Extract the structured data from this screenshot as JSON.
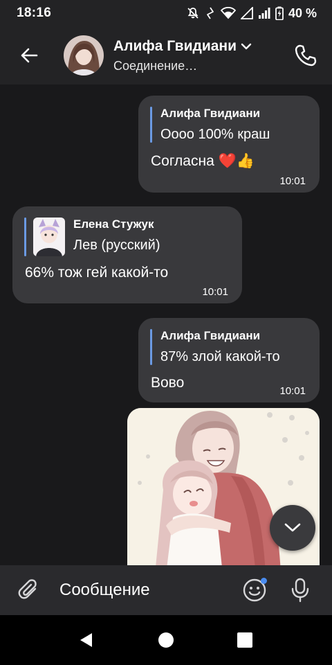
{
  "status_bar": {
    "time": "18:16",
    "battery_percent": "40 %",
    "icons": [
      "mute-icon",
      "vibrate-icon",
      "wifi-icon",
      "signal-icon",
      "battery-charging-icon"
    ]
  },
  "header": {
    "contact_name": "Алифа Гвидиани",
    "status": "Соединение…",
    "icons": [
      "back-arrow-icon",
      "chevron-down-icon",
      "phone-icon"
    ]
  },
  "messages": [
    {
      "direction": "outgoing",
      "reply_to": {
        "name": "Алифа Гвидиани",
        "text": "Оооо 100% краш"
      },
      "text": "Согласна ❤️👍",
      "time": "10:01"
    },
    {
      "direction": "incoming",
      "reply_to": {
        "name": "Елена Стужук",
        "text": "Лев (русский)",
        "has_thumbnail": true
      },
      "text": "66% тож гей какой-то",
      "time": "10:01"
    },
    {
      "direction": "outgoing",
      "reply_to": {
        "name": "Алифа Гвидиани",
        "text": "87% злой какой-то"
      },
      "text": "Вово",
      "time": "10:01"
    },
    {
      "direction": "outgoing",
      "type": "image",
      "description_icon": "anime-couple-illustration"
    }
  ],
  "composer": {
    "placeholder": "Сообщение",
    "icons": [
      "attach-icon",
      "emoji-icon",
      "microphone-icon"
    ]
  },
  "nav_bar": {
    "icons": [
      "back-triangle-icon",
      "home-circle-icon",
      "recents-square-icon"
    ]
  },
  "colors": {
    "background": "#19191b",
    "header": "#232325",
    "bubble": "#39393c",
    "quote_bar": "#6b9ae3",
    "unread_dot": "#4a8cf0"
  }
}
